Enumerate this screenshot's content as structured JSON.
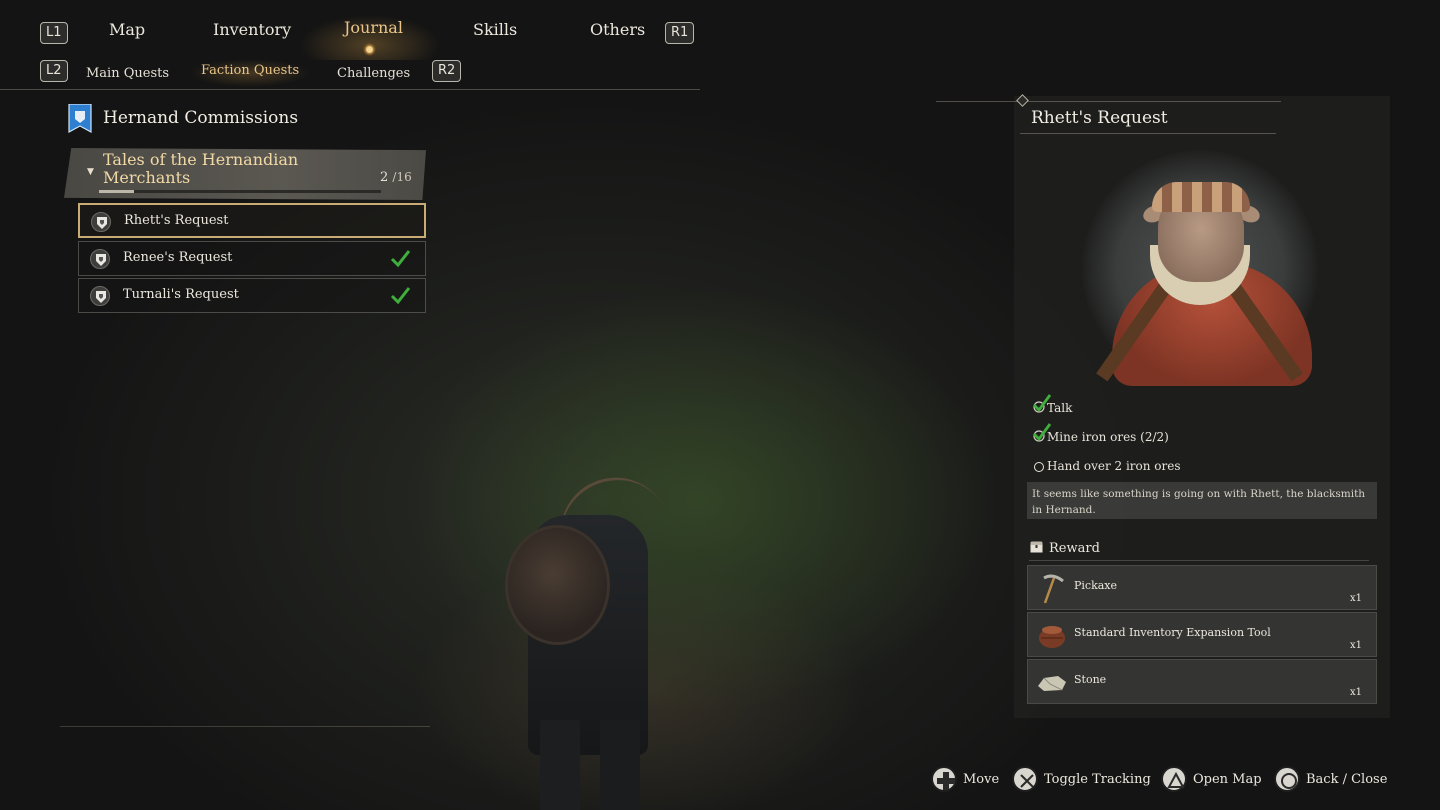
{
  "nav": {
    "l1": "L1",
    "r1": "R1",
    "l2": "L2",
    "r2": "R2",
    "tabs": [
      {
        "label": "Map"
      },
      {
        "label": "Inventory"
      },
      {
        "label": "Journal",
        "active": true
      },
      {
        "label": "Skills"
      },
      {
        "label": "Others"
      }
    ],
    "subtabs": [
      {
        "label": "Main Quests"
      },
      {
        "label": "Faction Quests",
        "active": true
      },
      {
        "label": "Challenges"
      }
    ]
  },
  "left_panel": {
    "title": "Hernand Commissions",
    "group": {
      "title": "Tales of the Hernandian Merchants",
      "count": "2",
      "total": "/16",
      "progress": 0.125
    },
    "quests": [
      {
        "label": "Rhett's Request",
        "selected": true,
        "completed": false
      },
      {
        "label": "Renee's Request",
        "selected": false,
        "completed": true
      },
      {
        "label": "Turnali's Request",
        "selected": false,
        "completed": true
      }
    ]
  },
  "detail": {
    "title": "Rhett's Request",
    "objectives": [
      {
        "label": "Talk",
        "done": true
      },
      {
        "label": "Mine iron ores (2/2)",
        "done": true
      },
      {
        "label": "Hand over 2 iron ores",
        "done": false
      }
    ],
    "description": "It seems like something is going on with Rhett, the blacksmith in Hernand.",
    "reward_heading": "Reward",
    "rewards": [
      {
        "name": "Pickaxe",
        "qty": "x1",
        "icon": "pickaxe-icon"
      },
      {
        "name": "Standard Inventory Expansion Tool",
        "qty": "x1",
        "icon": "bag-icon"
      },
      {
        "name": "Stone",
        "qty": "x1",
        "icon": "stone-icon"
      }
    ]
  },
  "prompts": [
    {
      "label": "Move",
      "icon": "dpad-icon"
    },
    {
      "label": "Toggle Tracking",
      "icon": "cross-button-icon"
    },
    {
      "label": "Open Map",
      "icon": "triangle-button-icon"
    },
    {
      "label": "Back / Close",
      "icon": "circle-button-icon"
    }
  ],
  "colors": {
    "accent_gold": "#e9c58a",
    "check_green": "#3fae3a",
    "text": "#e6e1d6"
  }
}
